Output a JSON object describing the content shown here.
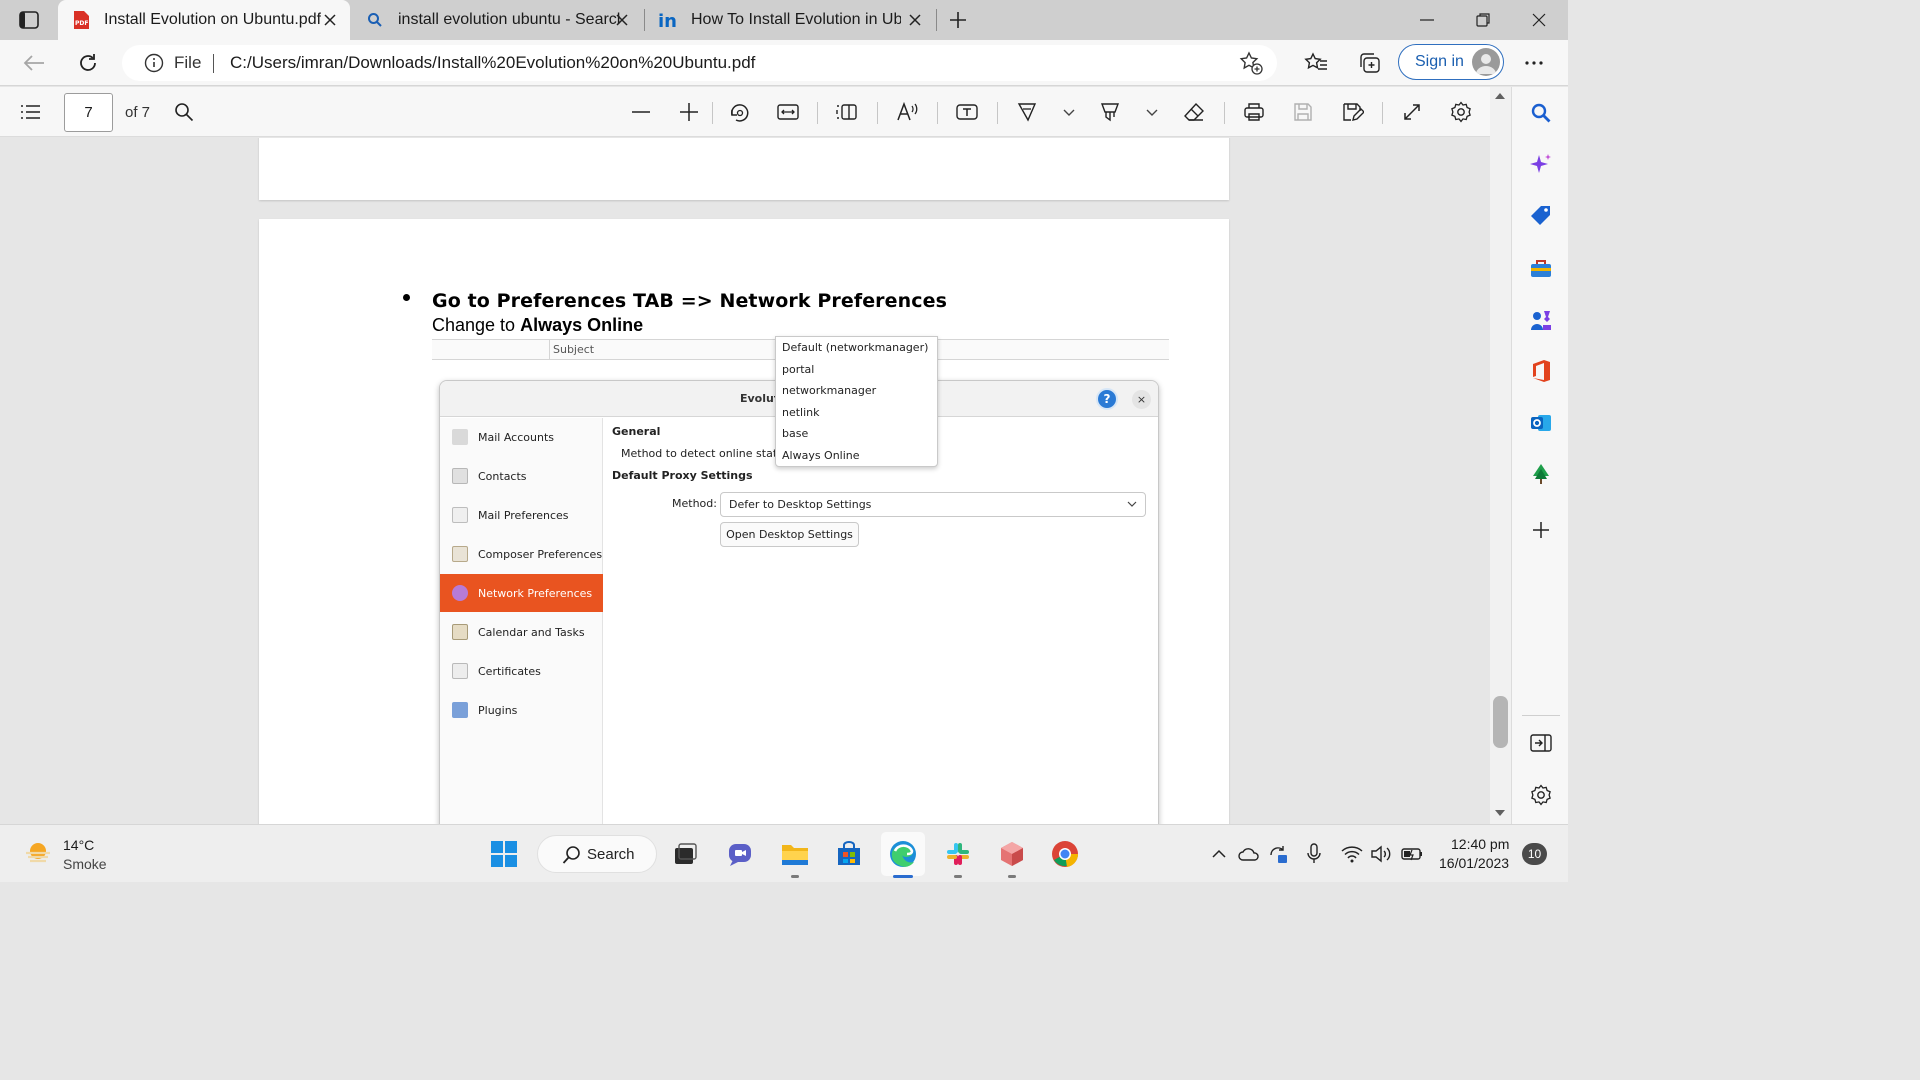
{
  "browser": {
    "tabs": [
      {
        "title": "Install Evolution on Ubuntu.pdf",
        "icon": "pdf-icon",
        "active": true
      },
      {
        "title": "install evolution ubuntu - Search",
        "icon": "search-icon",
        "active": false
      },
      {
        "title": "How To Install Evolution in Ubuntu",
        "icon": "linkedin-icon",
        "active": false
      }
    ],
    "address": {
      "scheme_label": "File",
      "url": "C:/Users/imran/Downloads/Install%20Evolution%20on%20Ubuntu.pdf"
    },
    "signin_label": "Sign in"
  },
  "pdf_toolbar": {
    "current_page": "7",
    "total_pages": "of 7"
  },
  "document": {
    "heading": "Go to Preferences TAB => Network Preferences",
    "subline_prefix": "Change to ",
    "subline_bold": "Always Online",
    "screenshot": {
      "subject_column": "Subject",
      "dialog_title": "Evolut",
      "help_label": "?",
      "close_label": "×",
      "sidebar_items": [
        {
          "label": "Mail Accounts",
          "icon": "mail-accounts-icon",
          "active": false
        },
        {
          "label": "Contacts",
          "icon": "contacts-icon",
          "active": false
        },
        {
          "label": "Mail Preferences",
          "icon": "mail-preferences-icon",
          "active": false
        },
        {
          "label": "Composer Preferences",
          "icon": "composer-icon",
          "active": false
        },
        {
          "label": "Network Preferences",
          "icon": "network-icon",
          "active": true
        },
        {
          "label": "Calendar and Tasks",
          "icon": "calendar-icon",
          "active": false
        },
        {
          "label": "Certificates",
          "icon": "certificates-icon",
          "active": false
        },
        {
          "label": "Plugins",
          "icon": "plugins-icon",
          "active": false
        }
      ],
      "general_label": "General",
      "detect_label": "Method to detect online state:",
      "proxy_label": "Default Proxy Settings",
      "method_label": "Method:",
      "method_value": "Defer to Desktop Settings",
      "open_desktop_button": "Open Desktop Settings",
      "dropdown_options": [
        "Default (networkmanager)",
        "portal",
        "networkmanager",
        "netlink",
        "base",
        "Always Online"
      ]
    }
  },
  "taskbar": {
    "weather_temp": "14°C",
    "weather_desc": "Smoke",
    "search_label": "Search",
    "time": "12:40 pm",
    "date": "16/01/2023",
    "notification_count": "10"
  }
}
